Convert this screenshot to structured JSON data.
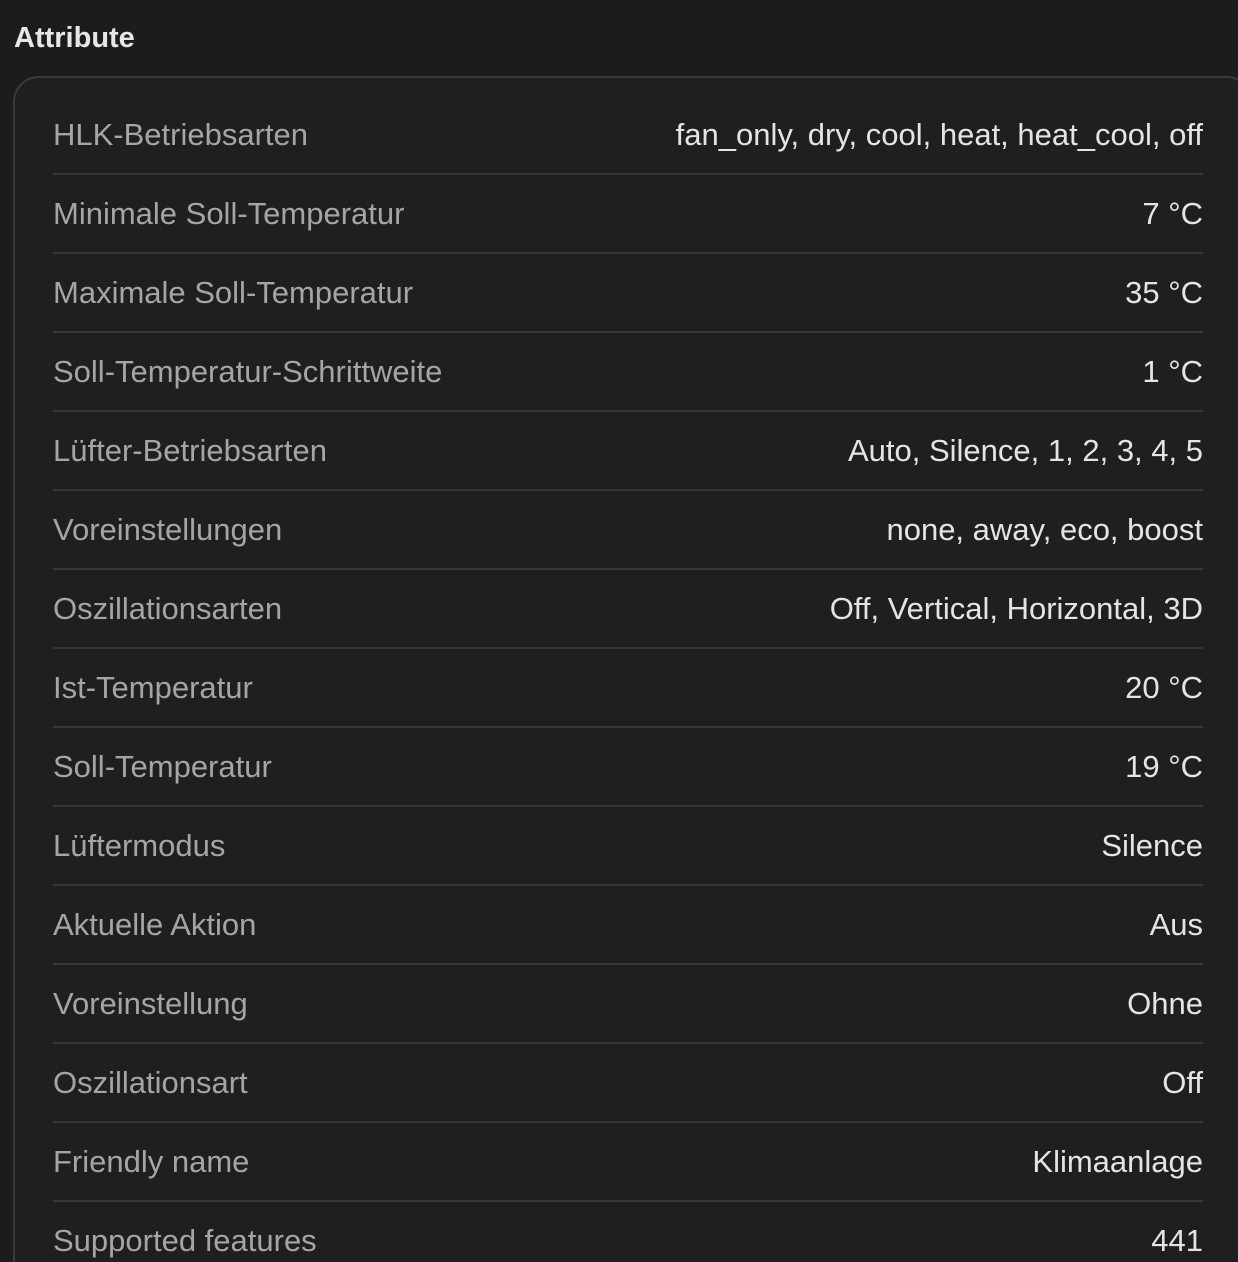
{
  "section": {
    "title": "Attribute"
  },
  "attributes": [
    {
      "name": "HLK-Betriebsarten",
      "value": "fan_only, dry, cool, heat, heat_cool, off"
    },
    {
      "name": "Minimale Soll-Temperatur",
      "value": "7 °C"
    },
    {
      "name": "Maximale Soll-Temperatur",
      "value": "35 °C"
    },
    {
      "name": "Soll-Temperatur-Schrittweite",
      "value": "1 °C"
    },
    {
      "name": "Lüfter-Betriebsarten",
      "value": "Auto, Silence, 1, 2, 3, 4, 5"
    },
    {
      "name": "Voreinstellungen",
      "value": "none, away, eco, boost"
    },
    {
      "name": "Oszillationsarten",
      "value": "Off, Vertical, Horizontal, 3D"
    },
    {
      "name": "Ist-Temperatur",
      "value": "20 °C"
    },
    {
      "name": "Soll-Temperatur",
      "value": "19 °C"
    },
    {
      "name": "Lüftermodus",
      "value": "Silence"
    },
    {
      "name": "Aktuelle Aktion",
      "value": "Aus"
    },
    {
      "name": "Voreinstellung",
      "value": "Ohne"
    },
    {
      "name": "Oszillationsart",
      "value": "Off"
    },
    {
      "name": "Friendly name",
      "value": "Klimaanlage"
    },
    {
      "name": "Supported features",
      "value": "441"
    }
  ]
}
